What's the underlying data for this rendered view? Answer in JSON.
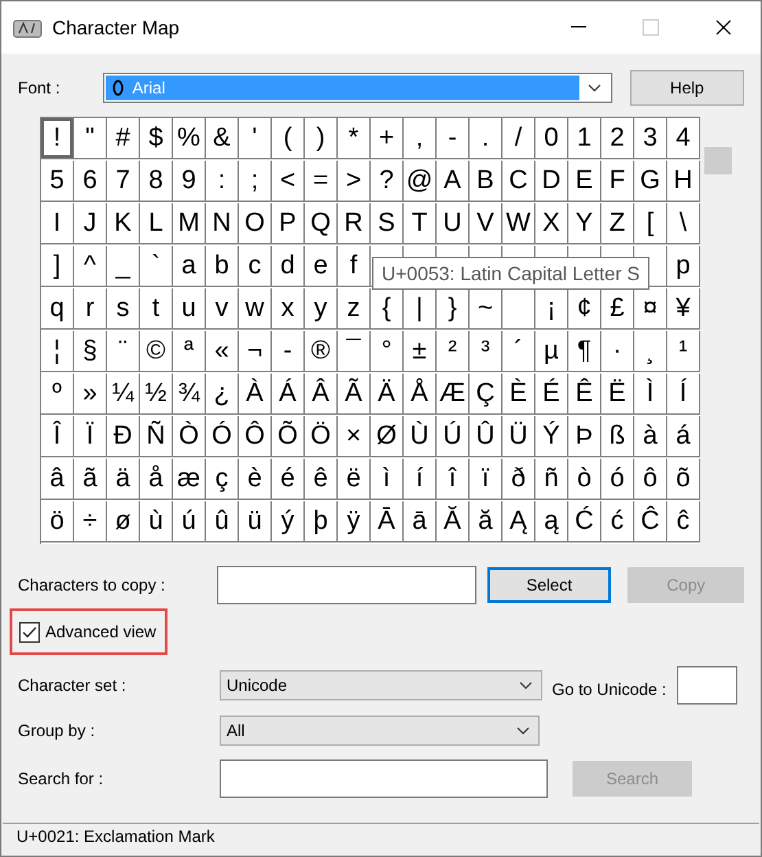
{
  "window": {
    "title": "Character Map"
  },
  "font": {
    "label": "Font :",
    "value": "Arial"
  },
  "help_button": "Help",
  "grid_rows": [
    [
      {
        "c": "!",
        "selected": true
      },
      {
        "c": "\"",
        "selected": false
      },
      {
        "c": "#",
        "selected": false
      },
      {
        "c": "$",
        "selected": false
      },
      {
        "c": "%",
        "selected": false
      },
      {
        "c": "&",
        "selected": false
      },
      {
        "c": "'",
        "selected": false
      },
      {
        "c": "(",
        "selected": false
      },
      {
        "c": ")",
        "selected": false
      },
      {
        "c": "*",
        "selected": false
      },
      {
        "c": "+",
        "selected": false
      },
      {
        "c": ",",
        "selected": false
      },
      {
        "c": "-",
        "selected": false
      },
      {
        "c": ".",
        "selected": false
      },
      {
        "c": "/",
        "selected": false
      },
      {
        "c": "0",
        "selected": false
      },
      {
        "c": "1",
        "selected": false
      },
      {
        "c": "2",
        "selected": false
      },
      {
        "c": "3",
        "selected": false
      },
      {
        "c": "4",
        "selected": false
      }
    ],
    [
      {
        "c": "5",
        "selected": false
      },
      {
        "c": "6",
        "selected": false
      },
      {
        "c": "7",
        "selected": false
      },
      {
        "c": "8",
        "selected": false
      },
      {
        "c": "9",
        "selected": false
      },
      {
        "c": ":",
        "selected": false
      },
      {
        "c": ";",
        "selected": false
      },
      {
        "c": "<",
        "selected": false
      },
      {
        "c": "=",
        "selected": false
      },
      {
        "c": ">",
        "selected": false
      },
      {
        "c": "?",
        "selected": false
      },
      {
        "c": "@",
        "selected": false
      },
      {
        "c": "A",
        "selected": false
      },
      {
        "c": "B",
        "selected": false
      },
      {
        "c": "C",
        "selected": false
      },
      {
        "c": "D",
        "selected": false
      },
      {
        "c": "E",
        "selected": false
      },
      {
        "c": "F",
        "selected": false
      },
      {
        "c": "G",
        "selected": false
      },
      {
        "c": "H",
        "selected": false
      }
    ],
    [
      {
        "c": "I",
        "selected": false
      },
      {
        "c": "J",
        "selected": false
      },
      {
        "c": "K",
        "selected": false
      },
      {
        "c": "L",
        "selected": false
      },
      {
        "c": "M",
        "selected": false
      },
      {
        "c": "N",
        "selected": false
      },
      {
        "c": "O",
        "selected": false
      },
      {
        "c": "P",
        "selected": false
      },
      {
        "c": "Q",
        "selected": false
      },
      {
        "c": "R",
        "selected": false
      },
      {
        "c": "S",
        "selected": false
      },
      {
        "c": "T",
        "selected": false
      },
      {
        "c": "U",
        "selected": false
      },
      {
        "c": "V",
        "selected": false
      },
      {
        "c": "W",
        "selected": false
      },
      {
        "c": "X",
        "selected": false
      },
      {
        "c": "Y",
        "selected": false
      },
      {
        "c": "Z",
        "selected": false
      },
      {
        "c": "[",
        "selected": false
      },
      {
        "c": "\\",
        "selected": false
      }
    ],
    [
      {
        "c": "]",
        "selected": false
      },
      {
        "c": "^",
        "selected": false
      },
      {
        "c": "_",
        "selected": false
      },
      {
        "c": "`",
        "selected": false
      },
      {
        "c": "a",
        "selected": false
      },
      {
        "c": "b",
        "selected": false
      },
      {
        "c": "c",
        "selected": false
      },
      {
        "c": "d",
        "selected": false
      },
      {
        "c": "e",
        "selected": false
      },
      {
        "c": "f",
        "selected": false
      },
      {
        "selected": false
      },
      {
        "selected": false
      },
      {
        "selected": false
      },
      {
        "selected": false
      },
      {
        "selected": false
      },
      {
        "selected": false
      },
      {
        "selected": false
      },
      {
        "selected": false
      },
      {
        "selected": false
      },
      {
        "c": "p",
        "selected": false
      }
    ],
    [
      {
        "c": "q",
        "selected": false
      },
      {
        "c": "r",
        "selected": false
      },
      {
        "c": "s",
        "selected": false
      },
      {
        "c": "t",
        "selected": false
      },
      {
        "c": "u",
        "selected": false
      },
      {
        "c": "v",
        "selected": false
      },
      {
        "c": "w",
        "selected": false
      },
      {
        "c": "x",
        "selected": false
      },
      {
        "c": "y",
        "selected": false
      },
      {
        "c": "z",
        "selected": false
      },
      {
        "c": "{",
        "selected": false
      },
      {
        "c": "|",
        "selected": false
      },
      {
        "c": "}",
        "selected": false
      },
      {
        "c": "~",
        "selected": false
      },
      {
        "selected": false
      },
      {
        "c": "¡",
        "selected": false
      },
      {
        "c": "¢",
        "selected": false
      },
      {
        "c": "£",
        "selected": false
      },
      {
        "c": "¤",
        "selected": false
      },
      {
        "c": "¥",
        "selected": false
      }
    ],
    [
      {
        "c": "¦",
        "selected": false
      },
      {
        "c": "§",
        "selected": false
      },
      {
        "c": "¨",
        "selected": false
      },
      {
        "c": "©",
        "selected": false
      },
      {
        "c": "ª",
        "selected": false
      },
      {
        "c": "«",
        "selected": false
      },
      {
        "c": "¬",
        "selected": false
      },
      {
        "c": "-",
        "selected": false
      },
      {
        "c": "®",
        "selected": false
      },
      {
        "c": "¯",
        "selected": false
      },
      {
        "c": "°",
        "selected": false
      },
      {
        "c": "±",
        "selected": false
      },
      {
        "c": "²",
        "selected": false
      },
      {
        "c": "³",
        "selected": false
      },
      {
        "c": "´",
        "selected": false
      },
      {
        "c": "µ",
        "selected": false
      },
      {
        "c": "¶",
        "selected": false
      },
      {
        "c": "·",
        "selected": false
      },
      {
        "c": "¸",
        "selected": false
      },
      {
        "c": "¹",
        "selected": false
      }
    ],
    [
      {
        "c": "º",
        "selected": false
      },
      {
        "c": "»",
        "selected": false
      },
      {
        "c": "¼",
        "selected": false
      },
      {
        "c": "½",
        "selected": false
      },
      {
        "c": "¾",
        "selected": false
      },
      {
        "c": "¿",
        "selected": false
      },
      {
        "c": "À",
        "selected": false
      },
      {
        "c": "Á",
        "selected": false
      },
      {
        "c": "Â",
        "selected": false
      },
      {
        "c": "Ã",
        "selected": false
      },
      {
        "c": "Ä",
        "selected": false
      },
      {
        "c": "Å",
        "selected": false
      },
      {
        "c": "Æ",
        "selected": false
      },
      {
        "c": "Ç",
        "selected": false
      },
      {
        "c": "È",
        "selected": false
      },
      {
        "c": "É",
        "selected": false
      },
      {
        "c": "Ê",
        "selected": false
      },
      {
        "c": "Ë",
        "selected": false
      },
      {
        "c": "Ì",
        "selected": false
      },
      {
        "c": "Í",
        "selected": false
      }
    ],
    [
      {
        "c": "Î",
        "selected": false
      },
      {
        "c": "Ï",
        "selected": false
      },
      {
        "c": "Ð",
        "selected": false
      },
      {
        "c": "Ñ",
        "selected": false
      },
      {
        "c": "Ò",
        "selected": false
      },
      {
        "c": "Ó",
        "selected": false
      },
      {
        "c": "Ô",
        "selected": false
      },
      {
        "c": "Õ",
        "selected": false
      },
      {
        "c": "Ö",
        "selected": false
      },
      {
        "c": "×",
        "selected": false
      },
      {
        "c": "Ø",
        "selected": false
      },
      {
        "c": "Ù",
        "selected": false
      },
      {
        "c": "Ú",
        "selected": false
      },
      {
        "c": "Û",
        "selected": false
      },
      {
        "c": "Ü",
        "selected": false
      },
      {
        "c": "Ý",
        "selected": false
      },
      {
        "c": "Þ",
        "selected": false
      },
      {
        "c": "ß",
        "selected": false
      },
      {
        "c": "à",
        "selected": false
      },
      {
        "c": "á",
        "selected": false
      }
    ],
    [
      {
        "c": "â",
        "selected": false
      },
      {
        "c": "ã",
        "selected": false
      },
      {
        "c": "ä",
        "selected": false
      },
      {
        "c": "å",
        "selected": false
      },
      {
        "c": "æ",
        "selected": false
      },
      {
        "c": "ç",
        "selected": false
      },
      {
        "c": "è",
        "selected": false
      },
      {
        "c": "é",
        "selected": false
      },
      {
        "c": "ê",
        "selected": false
      },
      {
        "c": "ë",
        "selected": false
      },
      {
        "c": "ì",
        "selected": false
      },
      {
        "c": "í",
        "selected": false
      },
      {
        "c": "î",
        "selected": false
      },
      {
        "c": "ï",
        "selected": false
      },
      {
        "c": "ð",
        "selected": false
      },
      {
        "c": "ñ",
        "selected": false
      },
      {
        "c": "ò",
        "selected": false
      },
      {
        "c": "ó",
        "selected": false
      },
      {
        "c": "ô",
        "selected": false
      },
      {
        "c": "õ",
        "selected": false
      }
    ],
    [
      {
        "c": "ö",
        "selected": false
      },
      {
        "c": "÷",
        "selected": false
      },
      {
        "c": "ø",
        "selected": false
      },
      {
        "c": "ù",
        "selected": false
      },
      {
        "c": "ú",
        "selected": false
      },
      {
        "c": "û",
        "selected": false
      },
      {
        "c": "ü",
        "selected": false
      },
      {
        "c": "ý",
        "selected": false
      },
      {
        "c": "þ",
        "selected": false
      },
      {
        "c": "ÿ",
        "selected": false
      },
      {
        "c": "Ā",
        "selected": false
      },
      {
        "c": "ā",
        "selected": false
      },
      {
        "c": "Ă",
        "selected": false
      },
      {
        "c": "ă",
        "selected": false
      },
      {
        "c": "Ą",
        "selected": false
      },
      {
        "c": "ą",
        "selected": false
      },
      {
        "c": "Ć",
        "selected": false
      },
      {
        "c": "ć",
        "selected": false
      },
      {
        "c": "Ĉ",
        "selected": false
      },
      {
        "c": "ĉ",
        "selected": false
      }
    ]
  ],
  "tooltip": "U+0053: Latin Capital Letter S",
  "copy_row": {
    "label": "Characters to copy :",
    "select_button": "Select",
    "copy_button": {
      "label": "Copy",
      "disabled": true
    }
  },
  "advanced_view": {
    "label": "Advanced view",
    "checked": true
  },
  "character_set": {
    "label": "Character set :",
    "value": "Unicode"
  },
  "go_to_unicode": {
    "label": "Go to Unicode :"
  },
  "group_by": {
    "label": "Group by :",
    "value": "All"
  },
  "search": {
    "label": "Search for :",
    "button": {
      "label": "Search",
      "disabled": true
    }
  },
  "status_bar": "U+0021: Exclamation Mark"
}
